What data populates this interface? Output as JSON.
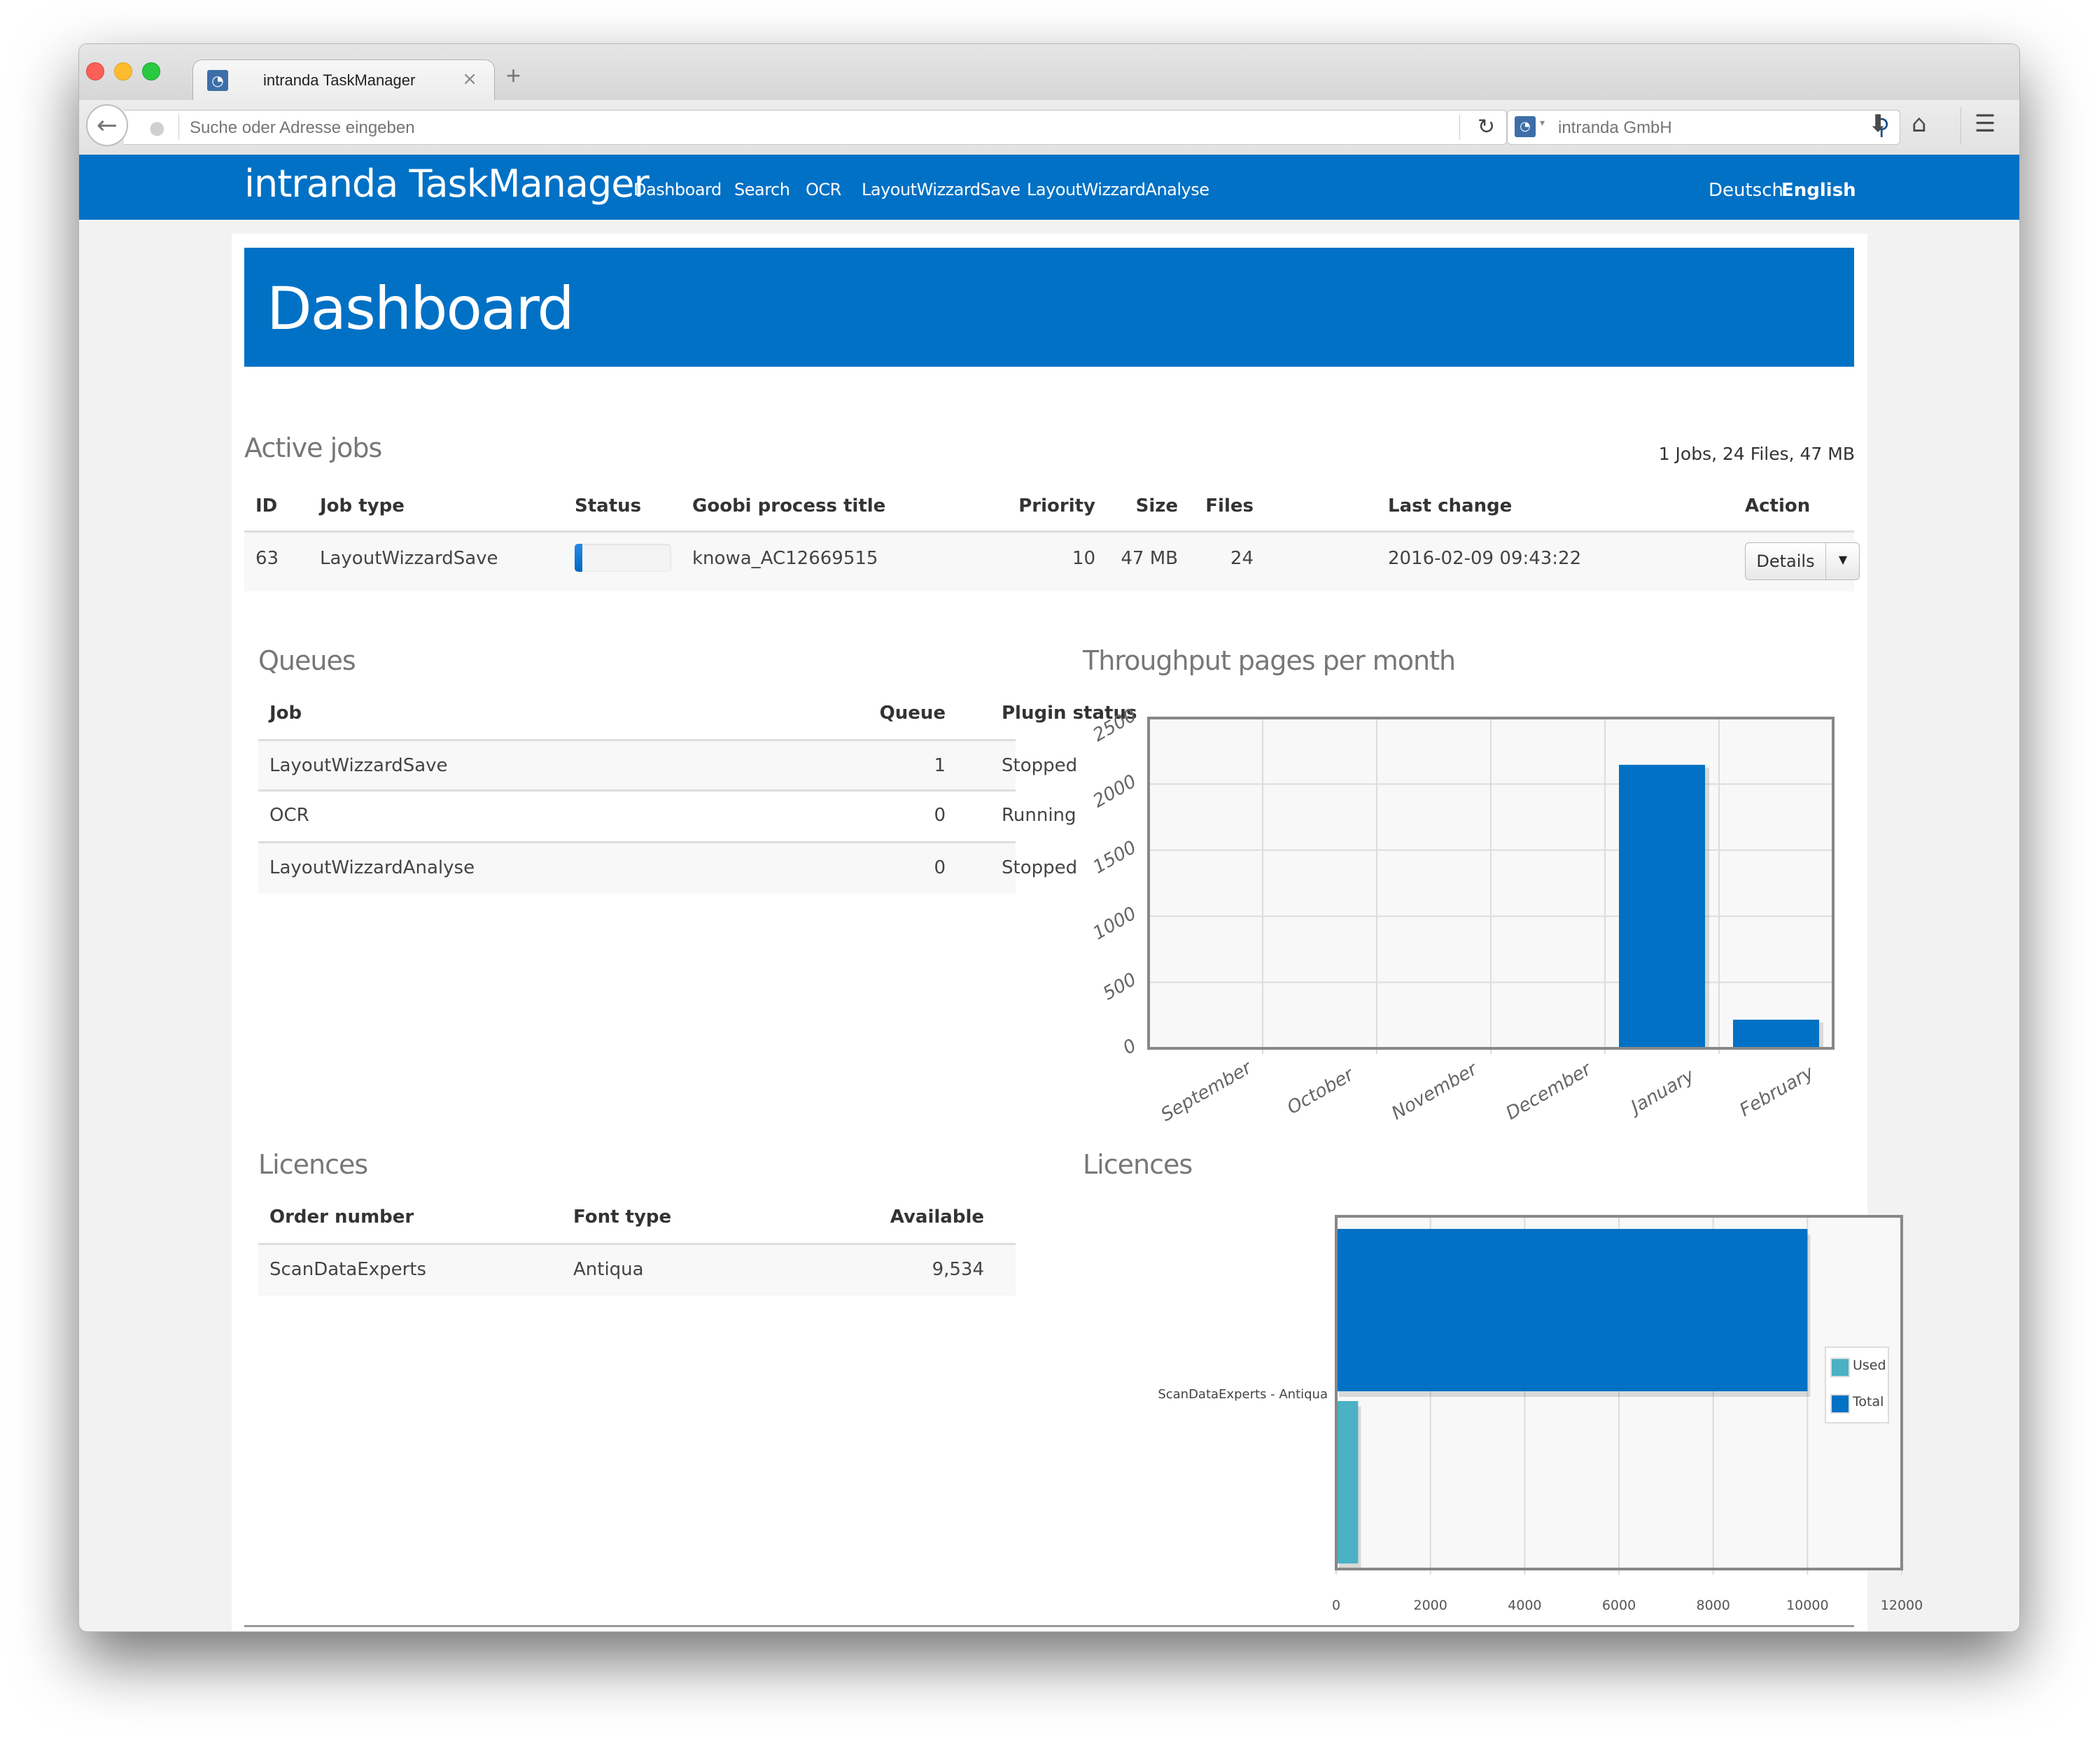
{
  "browser": {
    "tab_title": "intranda TaskManager",
    "url_placeholder": "Suche oder Adresse eingeben",
    "search_engine": "intranda GmbH",
    "icons": {
      "back": "arrow-left-icon",
      "site": "globe-icon",
      "reload": "reload-icon",
      "search": "magnifier-icon",
      "download": "download-arrow-icon",
      "home": "home-icon",
      "menu": "hamburger-menu-icon",
      "close_tab": "close-icon",
      "new_tab": "plus-icon"
    },
    "glyphs": {
      "back": "←",
      "globe": "●",
      "reload": "↻",
      "search": "⚲",
      "download": "⬇",
      "home": "⌂",
      "menu": "☰",
      "close": "×",
      "plus": "+",
      "caret": "▾",
      "favicon": "◔"
    }
  },
  "navbar": {
    "brand": "intranda TaskManager",
    "links": [
      "Dashboard",
      "Search",
      "OCR",
      "LayoutWizzardSave",
      "LayoutWizzardAnalyse"
    ],
    "languages": {
      "de": "Deutsch",
      "en": "English",
      "active": "English"
    }
  },
  "page": {
    "title": "Dashboard"
  },
  "active_jobs": {
    "title": "Active jobs",
    "summary": "1 Jobs, 24 Files, 47 MB",
    "columns": [
      "ID",
      "Job type",
      "Status",
      "Goobi process title",
      "Priority",
      "Size",
      "Files",
      "Last change",
      "Action"
    ],
    "rows": [
      {
        "id": "63",
        "job_type": "LayoutWizzardSave",
        "status_progress_percent": 8,
        "goobi_title": "knowa_AC12669515",
        "priority": "10",
        "size": "47 MB",
        "files": "24",
        "last_change": "2016-02-09 09:43:22",
        "action_label": "Details",
        "action_caret": "▼"
      }
    ]
  },
  "queues": {
    "title": "Queues",
    "columns": [
      "Job",
      "Queue",
      "Plugin status"
    ],
    "rows": [
      {
        "job": "LayoutWizzardSave",
        "queue": "1",
        "status": "Stopped"
      },
      {
        "job": "OCR",
        "queue": "0",
        "status": "Running"
      },
      {
        "job": "LayoutWizzardAnalyse",
        "queue": "0",
        "status": "Stopped"
      }
    ]
  },
  "licences_table": {
    "title": "Licences",
    "columns": [
      "Order number",
      "Font type",
      "Available"
    ],
    "rows": [
      {
        "order": "ScanDataExperts",
        "font": "Antiqua",
        "available": "9,534"
      }
    ]
  },
  "colors": {
    "brand": "#0071c5",
    "used": "#4bb1c4",
    "total": "#0071c5"
  },
  "chart_data": [
    {
      "type": "bar",
      "title": "Throughput pages per month",
      "categories": [
        "September",
        "October",
        "November",
        "December",
        "January",
        "February"
      ],
      "values": [
        0,
        0,
        0,
        0,
        2146,
        217
      ],
      "xlabel": "",
      "ylabel": "",
      "ylim": [
        0,
        2500
      ],
      "yticks": [
        0,
        500,
        1000,
        1500,
        2000,
        2500
      ],
      "grid": true,
      "legend": "none"
    },
    {
      "type": "bar",
      "orientation": "horizontal",
      "title": "Licences",
      "categories": [
        "ScanDataExperts - Antiqua"
      ],
      "series": [
        {
          "name": "Total",
          "values": [
            10000
          ]
        },
        {
          "name": "Used",
          "values": [
            466
          ]
        }
      ],
      "legend_order": [
        "Used",
        "Total"
      ],
      "xlim": [
        0,
        12000
      ],
      "xticks": [
        0,
        2000,
        4000,
        6000,
        8000,
        10000,
        12000
      ],
      "grid": true,
      "legend": "right"
    }
  ]
}
